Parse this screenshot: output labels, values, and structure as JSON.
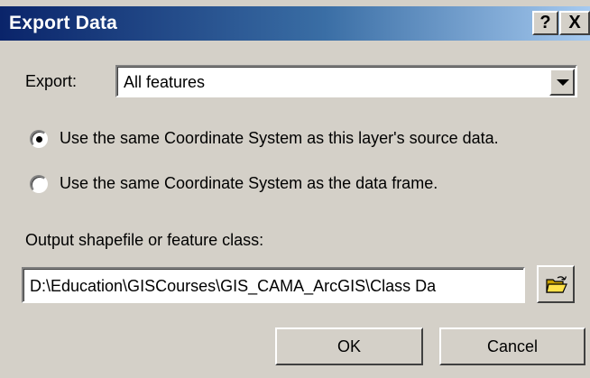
{
  "window": {
    "title": "Export Data",
    "help_label": "?",
    "close_label": "X"
  },
  "export": {
    "label": "Export:",
    "selected": "All features"
  },
  "coordinate_options": [
    {
      "label": "Use the same Coordinate System as this layer's source data.",
      "checked": true
    },
    {
      "label": "Use the same Coordinate System as the data frame.",
      "checked": false
    }
  ],
  "output": {
    "label": "Output shapefile or feature class:",
    "path": "D:\\Education\\GISCourses\\GIS_CAMA_ArcGIS\\Class Da"
  },
  "icons": {
    "browse": "open-folder-icon",
    "dropdown": "chevron-down-icon"
  },
  "buttons": {
    "ok": "OK",
    "cancel": "Cancel"
  }
}
